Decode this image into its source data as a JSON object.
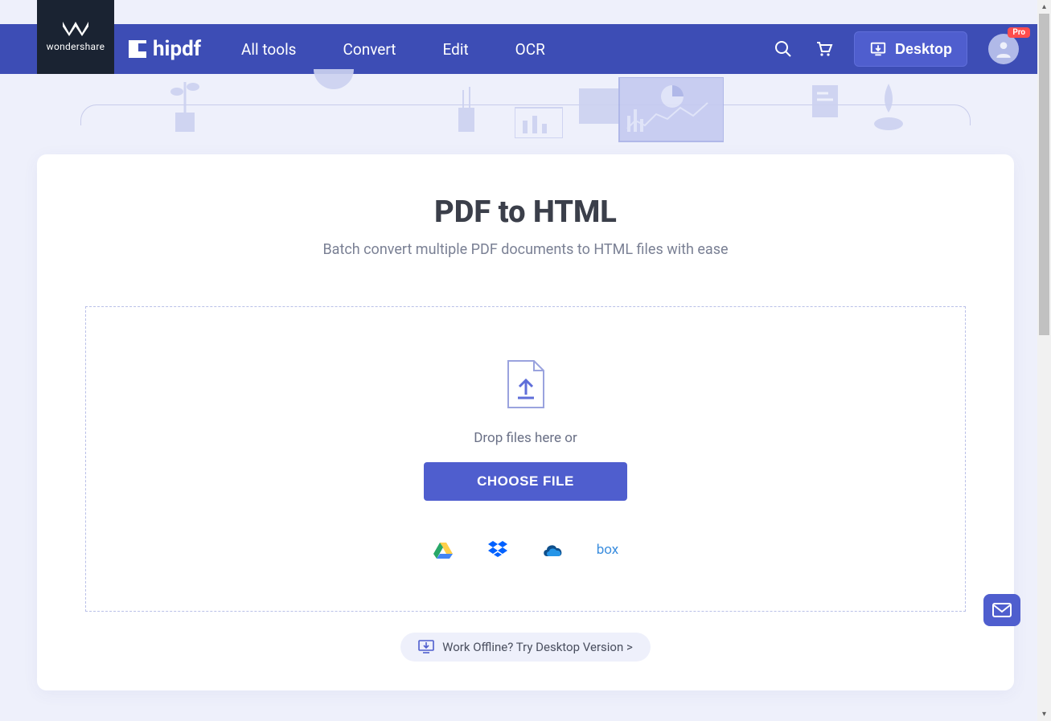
{
  "brand": {
    "name": "wondershare"
  },
  "logo": {
    "text": "hipdf"
  },
  "nav": {
    "items": [
      "All tools",
      "Convert",
      "Edit",
      "OCR"
    ]
  },
  "desktop_btn": {
    "label": "Desktop"
  },
  "avatar": {
    "badge": "Pro"
  },
  "page": {
    "title": "PDF to HTML",
    "subtitle": "Batch convert multiple PDF documents to HTML files with ease"
  },
  "dropzone": {
    "text": "Drop files here or",
    "button": "CHOOSE FILE"
  },
  "cloud_providers": {
    "box_label": "box"
  },
  "offline": {
    "text": "Work Offline? Try Desktop Version >"
  }
}
